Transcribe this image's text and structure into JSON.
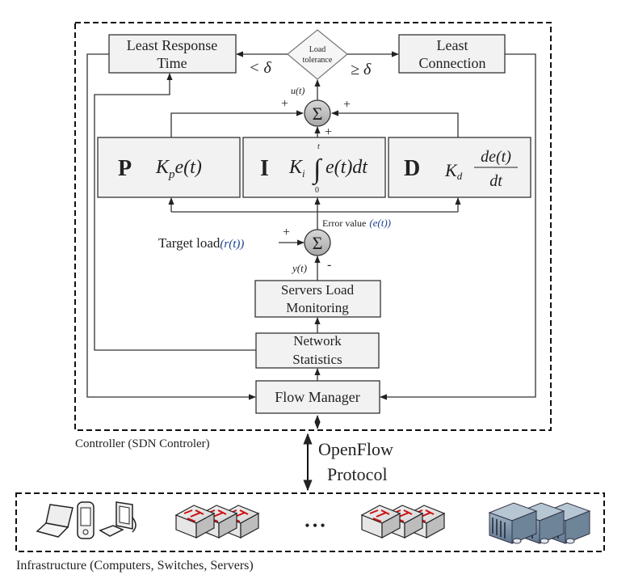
{
  "controller": {
    "label": "Controller (SDN Controler)",
    "least_response_time": [
      "Least Response",
      "Time"
    ],
    "least_connection": [
      "Least",
      "Connection"
    ],
    "load_tolerance": [
      "Load",
      "tolerance"
    ],
    "less_than_delta": "< δ",
    "greater_equal_delta": "≥ δ",
    "u_t": "u(t)",
    "sum_symbol": "Σ",
    "plus": "+",
    "minus": "-",
    "p_block": {
      "letter": "P",
      "formula": "K",
      "sub": "p",
      "tail": "e(t)"
    },
    "i_block": {
      "letter": "I",
      "formula": "K",
      "sub": "i",
      "tail": "e(t)dt",
      "upper": "t",
      "lower": "0",
      "integral": "∫"
    },
    "d_block": {
      "letter": "D",
      "formula": "K",
      "sub": "d",
      "num": "de(t)",
      "den": "dt"
    },
    "error_value": "Error value",
    "error_symbol": "(e(t))",
    "target_load": "Target load",
    "target_symbol": "(r(t))",
    "y_t": "y(t)",
    "servers_load_monitoring": [
      "Servers Load",
      "Monitoring"
    ],
    "network_statistics": [
      "Network",
      "Statistics"
    ],
    "flow_manager": "Flow Manager"
  },
  "protocol": [
    "OpenFlow",
    "Protocol"
  ],
  "infrastructure": {
    "label": "Infrastructure (Computers, Switches, Servers)",
    "ellipsis": "• • •",
    "icons": [
      "laptop-icon",
      "pda-icon",
      "desktop-icon",
      "switch-icon",
      "server-icon"
    ],
    "switch_arrow_color": "#cc1111",
    "server_color": "#7f98ad"
  }
}
